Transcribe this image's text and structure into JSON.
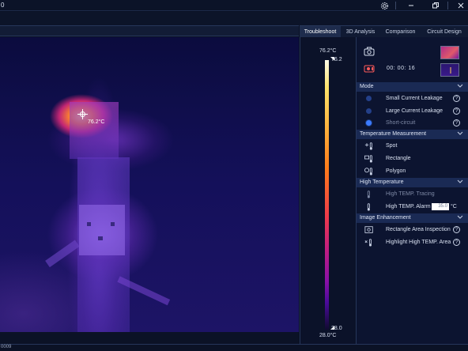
{
  "titlebar": {
    "left_text": "0",
    "icons": [
      "gear-icon",
      "minimize-icon",
      "restore-icon",
      "close-icon"
    ]
  },
  "tabs": [
    {
      "label": "Troubleshoot",
      "active": true
    },
    {
      "label": "3D Analysis",
      "active": false
    },
    {
      "label": "Comparison",
      "active": false
    },
    {
      "label": "Circuit Design",
      "active": false
    }
  ],
  "thermal": {
    "spot_temp": "76.2°C"
  },
  "scale": {
    "top_label": "76.2°C",
    "max_value": "76.2",
    "min_value": "28.0",
    "bottom_label": "28.0°C",
    "colors": [
      "#fffbe8",
      "#ffe36b",
      "#ffb640",
      "#ff7c1a",
      "#ee3a4a",
      "#c21e80",
      "#8a10a8",
      "#4a0a9a",
      "#100a30"
    ]
  },
  "media": {
    "timer": "00: 00: 16",
    "camera_icon": "camera-icon",
    "record_icon": "record-icon"
  },
  "sections": {
    "mode": {
      "title": "Mode",
      "items": [
        {
          "label": "Small Current Leakage",
          "selected": false,
          "enabled": true
        },
        {
          "label": "Large Current Leakage",
          "selected": false,
          "enabled": true
        },
        {
          "label": "Short-circuit",
          "selected": true,
          "enabled": false
        }
      ]
    },
    "temperature": {
      "title": "Temperature Measurement",
      "items": [
        {
          "label": "Spot",
          "icon": "spot-thermometer-icon"
        },
        {
          "label": "Rectangle",
          "icon": "rectangle-thermometer-icon"
        },
        {
          "label": "Polygon",
          "icon": "polygon-thermometer-icon"
        }
      ]
    },
    "high_temp": {
      "title": "High Temperature",
      "tracing_label": "High TEMP. Tracing",
      "alarm_label": "High TEMP. Alarm",
      "alarm_value": "35.0",
      "alarm_unit": "°C"
    },
    "image_enhancement": {
      "title": "Image Enhancement",
      "items": [
        {
          "label": "Rectangle Area Inspection",
          "icon": "rectangle-area-icon"
        },
        {
          "label": "Highlight High TEMP. Area",
          "icon": "highlight-thermometer-icon"
        }
      ]
    }
  },
  "bottom": {
    "left_text": "0009"
  }
}
